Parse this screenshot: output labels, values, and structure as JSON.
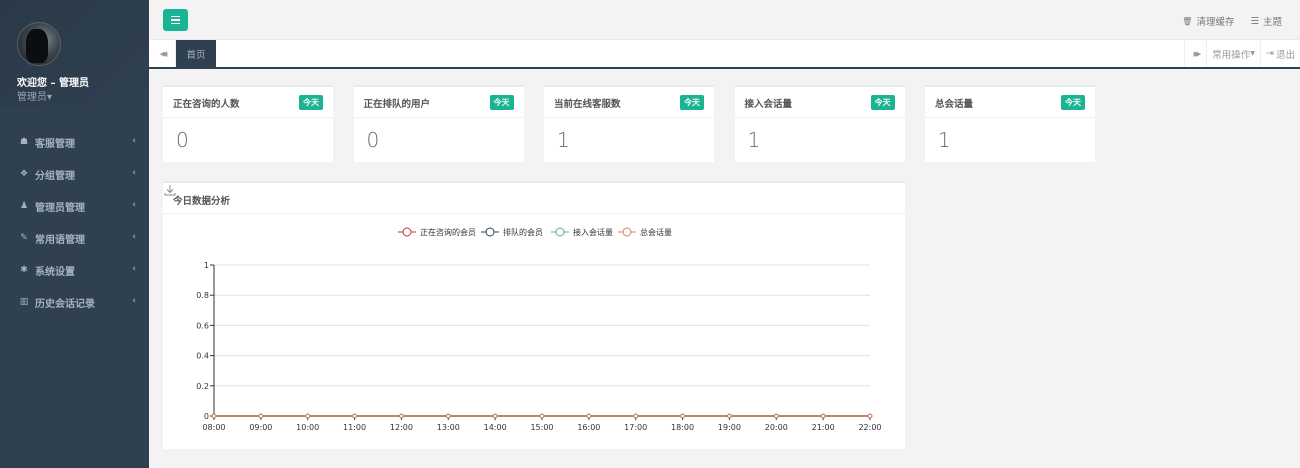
{
  "sidebar": {
    "welcome": "欢迎您 – 管理员",
    "role": "管理员",
    "role_caret": "▾",
    "items": [
      {
        "label": "客服管理",
        "icon": "headset-icon",
        "glyph": "☗"
      },
      {
        "label": "分组管理",
        "icon": "users-icon",
        "glyph": "❖"
      },
      {
        "label": "管理员管理",
        "icon": "user-icon",
        "glyph": "♟"
      },
      {
        "label": "常用语管理",
        "icon": "comments-icon",
        "glyph": "✎"
      },
      {
        "label": "系统设置",
        "icon": "gear-icon",
        "glyph": "✱"
      },
      {
        "label": "历史会话记录",
        "icon": "bar-chart-icon",
        "glyph": "▥"
      }
    ],
    "chevron": "‹"
  },
  "header": {
    "clear_cache": "清理缓存",
    "clear_cache_icon": "🗑",
    "theme": "主题",
    "theme_icon": "☰"
  },
  "tabs": {
    "prev_glyph": "◀◀",
    "active": "首页",
    "next_glyph": "▶▶",
    "common_ops": "常用操作",
    "common_ops_caret": "▾",
    "logout": "退出",
    "logout_icon": "⇥"
  },
  "cards": [
    {
      "title": "正在咨询的人数",
      "badge": "今天",
      "value": "0"
    },
    {
      "title": "正在排队的用户",
      "badge": "今天",
      "value": "0"
    },
    {
      "title": "当前在线客服数",
      "badge": "今天",
      "value": "1"
    },
    {
      "title": "接入会话量",
      "badge": "今天",
      "value": "1"
    },
    {
      "title": "总会话量",
      "badge": "今天",
      "value": "1"
    }
  ],
  "panel": {
    "title": "今日数据分析"
  },
  "chart_data": {
    "type": "line",
    "categories": [
      "08:00",
      "09:00",
      "10:00",
      "11:00",
      "12:00",
      "13:00",
      "14:00",
      "15:00",
      "16:00",
      "17:00",
      "18:00",
      "19:00",
      "20:00",
      "21:00",
      "22:00"
    ],
    "series": [
      {
        "name": "正在咨询的会员",
        "color": "#c23531",
        "values": [
          0,
          0,
          0,
          0,
          0,
          0,
          0,
          0,
          0,
          0,
          0,
          0,
          0,
          0,
          0
        ]
      },
      {
        "name": "排队的会员",
        "color": "#2f4554",
        "values": [
          0,
          0,
          0,
          0,
          0,
          0,
          0,
          0,
          0,
          0,
          0,
          0,
          0,
          0,
          0
        ]
      },
      {
        "name": "接入会话量",
        "color": "#61a0a8",
        "values": [
          0,
          0,
          0,
          0,
          0,
          0,
          0,
          0,
          0,
          0,
          0,
          0,
          0,
          0,
          0
        ]
      },
      {
        "name": "总会话量",
        "color": "#d48265",
        "values": [
          0,
          0,
          0,
          0,
          0,
          0,
          0,
          0,
          0,
          0,
          0,
          0,
          0,
          0,
          0
        ]
      }
    ],
    "ylim": [
      0,
      1
    ],
    "yticks": [
      "0",
      "0.2",
      "0.4",
      "0.6",
      "0.8",
      "1"
    ],
    "grid": true,
    "legend": "top-center"
  }
}
